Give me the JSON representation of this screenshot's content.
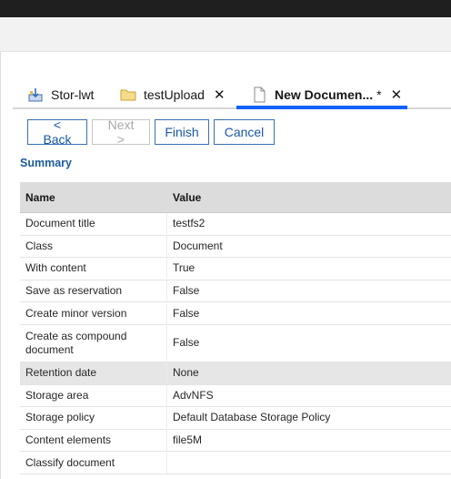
{
  "tabs": [
    {
      "label": "Stor-lwt",
      "icon": "repository-icon",
      "closable": false
    },
    {
      "label": "testUpload",
      "icon": "folder-icon",
      "closable": true
    },
    {
      "label": "New Documen...",
      "dirty_marker": "*",
      "icon": "document-icon",
      "closable": true,
      "active": true
    }
  ],
  "buttons": {
    "back": "< Back",
    "next": "Next >",
    "finish": "Finish",
    "cancel": "Cancel"
  },
  "summary": {
    "title": "Summary",
    "columns": [
      "Name",
      "Value"
    ],
    "rows": [
      {
        "name": "Document title",
        "value": "testfs2"
      },
      {
        "name": "Class",
        "value": "Document"
      },
      {
        "name": "With content",
        "value": "True"
      },
      {
        "name": "Save as reservation",
        "value": "False"
      },
      {
        "name": "Create minor version",
        "value": "False"
      },
      {
        "name": "Create as compound document",
        "value": "False"
      },
      {
        "name": "Retention date",
        "value": "None"
      },
      {
        "name": "Storage area",
        "value": "AdvNFS"
      },
      {
        "name": "Storage policy",
        "value": "Default Database Storage Policy"
      },
      {
        "name": "Content elements",
        "value": "file5M"
      },
      {
        "name": "Classify document",
        "value": ""
      }
    ]
  },
  "colors": {
    "accent": "#0f62fe",
    "link": "#1957a6",
    "section_title": "#1a5b9c",
    "header_bg": "#dcdcdc"
  }
}
